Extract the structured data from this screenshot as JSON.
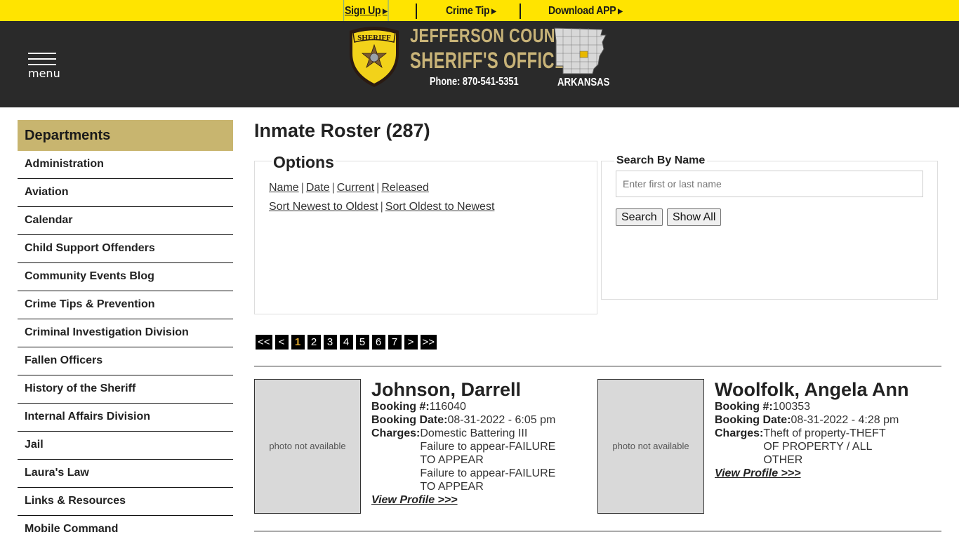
{
  "topbar": {
    "signup": "Sign Up",
    "crime_tip": "Crime Tip",
    "download_app": "Download APP"
  },
  "header": {
    "menu_label": "menu",
    "title_line1": "JEFFERSON COUNTY",
    "title_line2": "SHERIFF'S OFFICE",
    "phone": "Phone: 870-541-5351",
    "state": "ARKANSAS",
    "badge_text": "SHERIFF"
  },
  "colors": {
    "topbar": "#ffe400",
    "header": "#2a2a2a",
    "gold": "#c8b378",
    "sidebar_head": "#c8b56f",
    "pager_active": "#e0a82e"
  },
  "sidebar": {
    "title": "Departments",
    "items": [
      "Administration",
      "Aviation",
      "Calendar",
      "Child Support Offenders",
      "Community Events Blog",
      "Crime Tips & Prevention",
      "Criminal Investigation Division",
      "Fallen Officers",
      "History of the Sheriff",
      "Internal Affairs Division",
      "Jail",
      "Laura's Law",
      "Links & Resources",
      "Mobile Command"
    ]
  },
  "main": {
    "title": "Inmate Roster (287)",
    "options": {
      "legend": "Options",
      "filters": [
        "Name",
        "Date",
        "Current",
        "Released"
      ],
      "sorts": [
        "Sort Newest to Oldest",
        "Sort Oldest to Newest"
      ]
    },
    "search": {
      "legend": "Search By Name",
      "placeholder": "Enter first or last name",
      "value": "",
      "search_button": "Search",
      "show_all_button": "Show All"
    },
    "pager": {
      "first": "<<",
      "prev": "<",
      "pages": [
        "1",
        "2",
        "3",
        "4",
        "5",
        "6",
        "7"
      ],
      "current": "1",
      "next": ">",
      "last": ">>"
    },
    "inmates": [
      {
        "name": "Johnson, Darrell",
        "photo": "photo not available",
        "booking_label": "Booking #:",
        "booking_no": "116040",
        "date_label": "Booking Date:",
        "booking_date": "08-31-2022 - 6:05 pm",
        "charges_label": "Charges:",
        "charges": [
          "Domestic Battering III",
          "Failure to appear-FAILURE TO APPEAR",
          "Failure to appear-FAILURE TO APPEAR"
        ],
        "view_profile": "View Profile >>>"
      },
      {
        "name": "Woolfolk, Angela Ann",
        "photo": "photo not available",
        "booking_label": "Booking #:",
        "booking_no": "100353",
        "date_label": "Booking Date:",
        "booking_date": "08-31-2022 - 4:28 pm",
        "charges_label": "Charges:",
        "charges": [
          "Theft of property-THEFT OF PROPERTY / ALL OTHER"
        ],
        "view_profile": "View Profile >>>"
      }
    ]
  }
}
